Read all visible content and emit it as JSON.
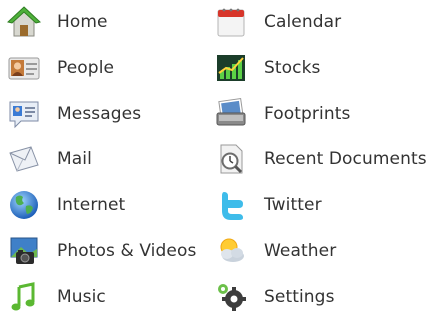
{
  "menu": {
    "left": [
      {
        "label": "Home",
        "icon": "home-icon"
      },
      {
        "label": "People",
        "icon": "people-icon"
      },
      {
        "label": "Messages",
        "icon": "messages-icon"
      },
      {
        "label": "Mail",
        "icon": "mail-icon"
      },
      {
        "label": "Internet",
        "icon": "internet-icon"
      },
      {
        "label": "Photos & Videos",
        "icon": "photos-videos-icon"
      },
      {
        "label": "Music",
        "icon": "music-icon"
      }
    ],
    "right": [
      {
        "label": "Calendar",
        "icon": "calendar-icon"
      },
      {
        "label": "Stocks",
        "icon": "stocks-icon"
      },
      {
        "label": "Footprints",
        "icon": "footprints-icon"
      },
      {
        "label": "Recent Documents",
        "icon": "recent-documents-icon"
      },
      {
        "label": "Twitter",
        "icon": "twitter-icon"
      },
      {
        "label": "Weather",
        "icon": "weather-icon"
      },
      {
        "label": "Settings",
        "icon": "settings-icon"
      }
    ]
  },
  "colors": {
    "text": "#333333",
    "background": "#ffffff"
  }
}
